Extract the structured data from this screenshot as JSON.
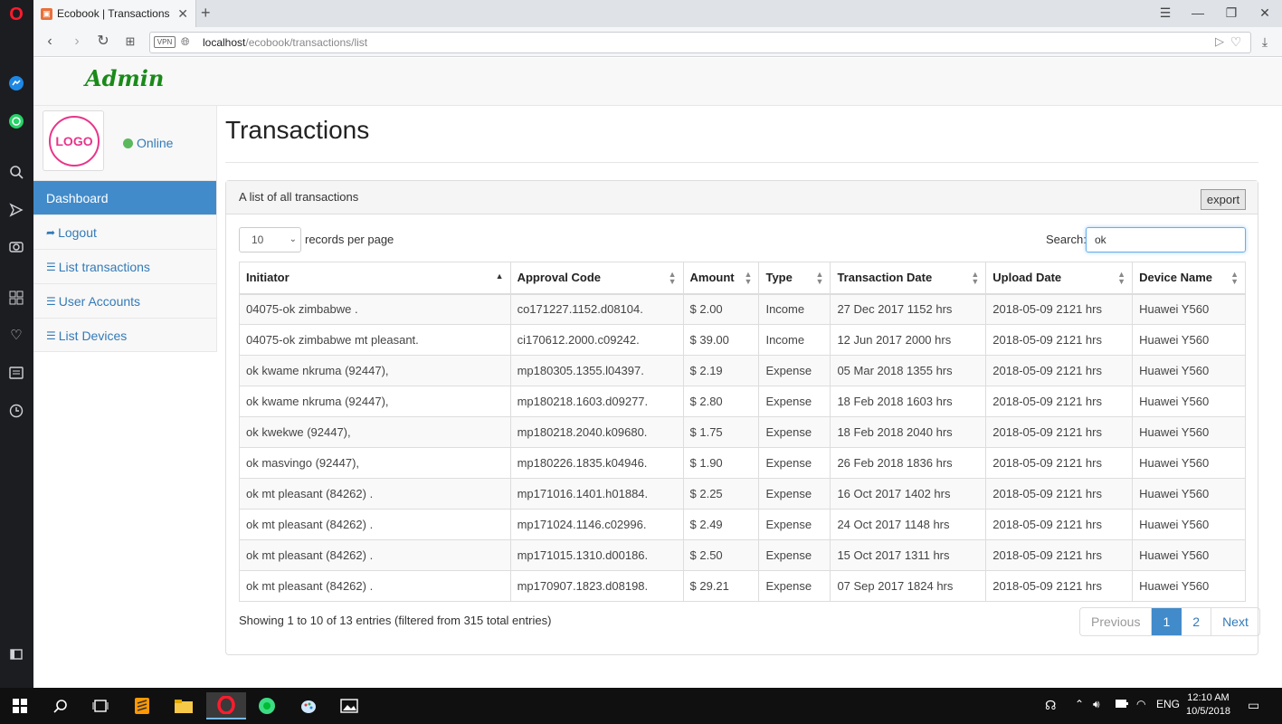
{
  "browser": {
    "tab_title": "Ecobook | Transactions",
    "tab_close": "✕",
    "new_tab": "+",
    "vpn": "VPN",
    "url_host": "localhost",
    "url_path": "/ecobook/transactions/list"
  },
  "app": {
    "brand": "Admin",
    "logo_text": "LOGO",
    "status": "Online"
  },
  "sidebar": {
    "items": [
      {
        "label": "Dashboard",
        "icon": "",
        "active": true
      },
      {
        "label": "Logout",
        "icon": "logout-icon"
      },
      {
        "label": "List transactions",
        "icon": "list-icon"
      },
      {
        "label": "User Accounts",
        "icon": "list-icon"
      },
      {
        "label": "List Devices",
        "icon": "list-icon"
      }
    ]
  },
  "main": {
    "title": "Transactions",
    "panel_title": "A list of all transactions",
    "export_label": "export",
    "length_value": "10",
    "length_label": "records per page",
    "search_label": "Search:",
    "search_value": "ok",
    "columns": [
      "Initiator",
      "Approval Code",
      "Amount",
      "Type",
      "Transaction Date",
      "Upload Date",
      "Device Name"
    ],
    "rows": [
      [
        "04075-ok zimbabwe .",
        "co171227.1152.d08104.",
        "$ 2.00",
        "Income",
        "27 Dec 2017 1152 hrs",
        "2018-05-09 2121 hrs",
        "Huawei Y560"
      ],
      [
        "04075-ok zimbabwe mt pleasant.",
        "ci170612.2000.c09242.",
        "$ 39.00",
        "Income",
        "12 Jun 2017 2000 hrs",
        "2018-05-09 2121 hrs",
        "Huawei Y560"
      ],
      [
        "ok kwame nkruma (92447),",
        "mp180305.1355.l04397.",
        "$ 2.19",
        "Expense",
        "05 Mar 2018 1355 hrs",
        "2018-05-09 2121 hrs",
        "Huawei Y560"
      ],
      [
        "ok kwame nkruma (92447),",
        "mp180218.1603.d09277.",
        "$ 2.80",
        "Expense",
        "18 Feb 2018 1603 hrs",
        "2018-05-09 2121 hrs",
        "Huawei Y560"
      ],
      [
        "ok kwekwe (92447),",
        "mp180218.2040.k09680.",
        "$ 1.75",
        "Expense",
        "18 Feb 2018 2040 hrs",
        "2018-05-09 2121 hrs",
        "Huawei Y560"
      ],
      [
        "ok masvingo (92447),",
        "mp180226.1835.k04946.",
        "$ 1.90",
        "Expense",
        "26 Feb 2018 1836 hrs",
        "2018-05-09 2121 hrs",
        "Huawei Y560"
      ],
      [
        "ok mt pleasant (84262) .",
        "mp171016.1401.h01884.",
        "$ 2.25",
        "Expense",
        "16 Oct 2017 1402 hrs",
        "2018-05-09 2121 hrs",
        "Huawei Y560"
      ],
      [
        "ok mt pleasant (84262) .",
        "mp171024.1146.c02996.",
        "$ 2.49",
        "Expense",
        "24 Oct 2017 1148 hrs",
        "2018-05-09 2121 hrs",
        "Huawei Y560"
      ],
      [
        "ok mt pleasant (84262) .",
        "mp171015.1310.d00186.",
        "$ 2.50",
        "Expense",
        "15 Oct 2017 1311 hrs",
        "2018-05-09 2121 hrs",
        "Huawei Y560"
      ],
      [
        "ok mt pleasant (84262) .",
        "mp170907.1823.d08198.",
        "$ 29.21",
        "Expense",
        "07 Sep 2017 1824 hrs",
        "2018-05-09 2121 hrs",
        "Huawei Y560"
      ]
    ],
    "info": "Showing 1 to 10 of 13 entries (filtered from 315 total entries)",
    "pager": {
      "previous": "Previous",
      "page1": "1",
      "page2": "2",
      "next": "Next"
    }
  },
  "taskbar": {
    "lang": "ENG",
    "time": "12:10 AM",
    "date": "10/5/2018"
  }
}
